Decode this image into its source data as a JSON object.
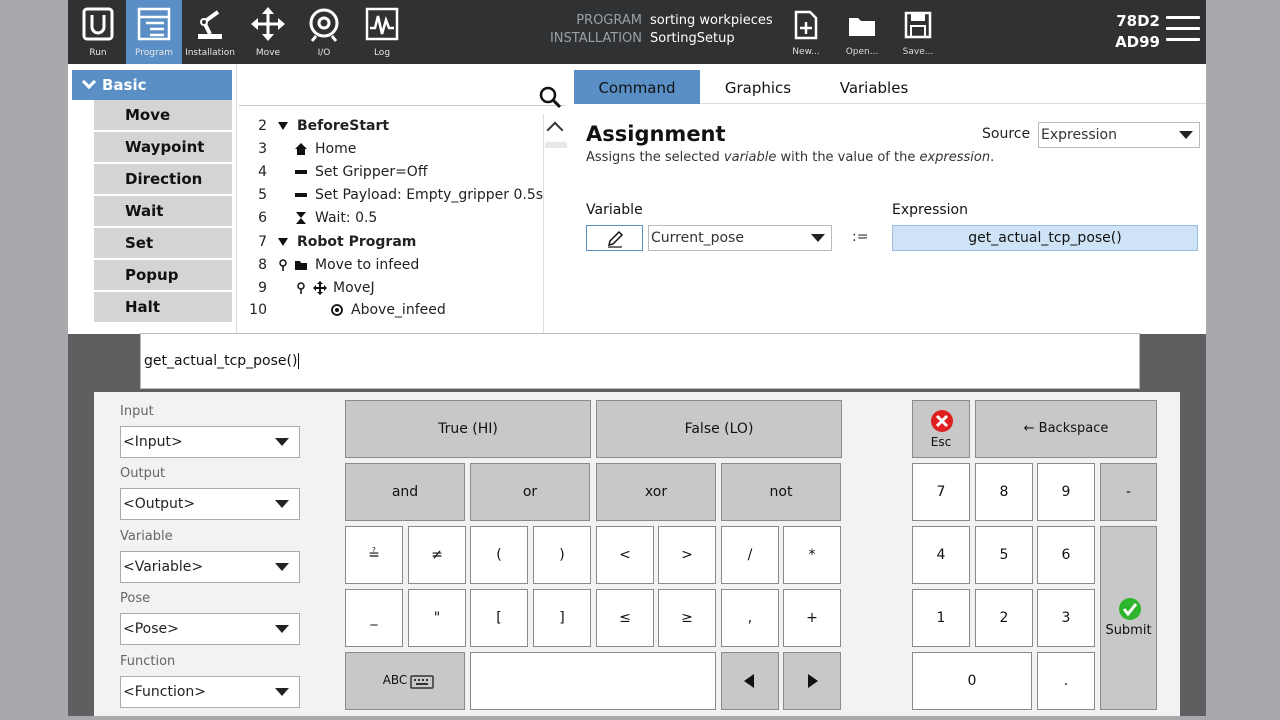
{
  "nav": [
    {
      "label": "Run",
      "icon": "ur-logo-icon"
    },
    {
      "label": "Program",
      "icon": "program-icon"
    },
    {
      "label": "Installation",
      "icon": "robot-arm-icon"
    },
    {
      "label": "Move",
      "icon": "move-arrows-icon"
    },
    {
      "label": "I/O",
      "icon": "io-icon"
    },
    {
      "label": "Log",
      "icon": "log-icon"
    }
  ],
  "header": {
    "program_key": "PROGRAM",
    "program_value": "sorting workpieces",
    "installation_key": "INSTALLATION",
    "installation_value": "SortingSetup",
    "new_label": "New...",
    "open_label": "Open...",
    "save_label": "Save...",
    "serial_line1": "78D2",
    "serial_line2": "AD99"
  },
  "palette": {
    "title": "Basic",
    "items": [
      "Move",
      "Waypoint",
      "Direction",
      "Wait",
      "Set",
      "Popup",
      "Halt"
    ]
  },
  "tree": {
    "rows": [
      {
        "num": "2",
        "text": "BeforeStart",
        "bold": true
      },
      {
        "num": "3",
        "text": "Home"
      },
      {
        "num": "4",
        "text": "Set Gripper=Off"
      },
      {
        "num": "5",
        "text": "Set Payload: Empty_gripper 0.5s"
      },
      {
        "num": "6",
        "text": "Wait: 0.5"
      },
      {
        "num": "7",
        "text": "Robot Program",
        "bold": true
      },
      {
        "num": "8",
        "text": "Move to infeed"
      },
      {
        "num": "9",
        "text": "MoveJ"
      },
      {
        "num": "10",
        "text": "Above_infeed"
      }
    ]
  },
  "tabs": [
    "Command",
    "Graphics",
    "Variables"
  ],
  "assignment": {
    "title": "Assignment",
    "desc_pre": "Assigns the selected ",
    "desc_var": "variable",
    "desc_mid": " with the value of the ",
    "desc_exp": "expression",
    "desc_end": ".",
    "source_label": "Source",
    "source_value": "Expression",
    "variable_label": "Variable",
    "variable_value": "Current_pose",
    "assign_op": ":=",
    "expression_label": "Expression",
    "expression_value": "get_actual_tcp_pose()"
  },
  "editor": {
    "text": "get_actual_tcp_pose()"
  },
  "dropdowns": [
    {
      "label": "Input",
      "value": "<Input>"
    },
    {
      "label": "Output",
      "value": "<Output>"
    },
    {
      "label": "Variable",
      "value": "<Variable>"
    },
    {
      "label": "Pose",
      "value": "<Pose>"
    },
    {
      "label": "Function",
      "value": "<Function>"
    }
  ],
  "keys": {
    "true_hi": "True (HI)",
    "false_lo": "False (LO)",
    "and": "and",
    "or": "or",
    "xor": "xor",
    "not": "not",
    "eq": "≟",
    "neq": "≠",
    "lpar": "(",
    "rpar": ")",
    "lt": "<",
    "gt": ">",
    "div": "/",
    "mul": "*",
    "underscore": "_",
    "quote": "\"",
    "lbr": "[",
    "rbr": "]",
    "le": "≤",
    "ge": "≥",
    "comma": ",",
    "plus": "+",
    "abc": "ABC",
    "esc": "Esc",
    "backspace": "Backspace",
    "n7": "7",
    "n8": "8",
    "n9": "9",
    "minus": "-",
    "n4": "4",
    "n5": "5",
    "n6": "6",
    "n1": "1",
    "n2": "2",
    "n3": "3",
    "n0": "0",
    "dot": ".",
    "submit": "Submit"
  },
  "colors": {
    "accent": "#5a8fc6",
    "topbar": "#2f3133",
    "esc_red": "#e02020",
    "submit_green": "#2db52d"
  }
}
